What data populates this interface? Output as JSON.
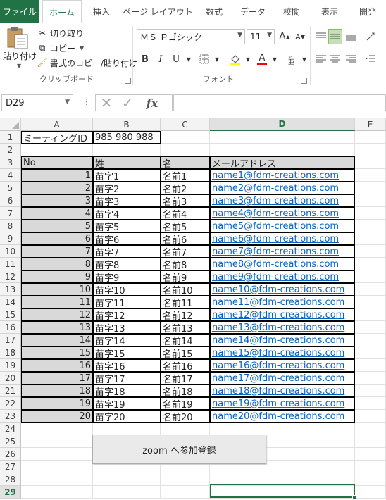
{
  "tabs": {
    "file": "ファイル",
    "items": [
      "ホーム",
      "挿入",
      "ページ レイアウト",
      "数式",
      "データ",
      "校閲",
      "表示",
      "開発"
    ]
  },
  "ribbon": {
    "clipboard": {
      "paste": "貼り付け",
      "cut": "切り取り",
      "copy": "コピー",
      "format_painter": "書式のコピー/貼り付け",
      "group_label": "クリップボード"
    },
    "font": {
      "font_name": "ＭＳ Ｐゴシック",
      "font_size": "11",
      "bold": "B",
      "italic": "I",
      "underline": "U",
      "font_color_letter": "A",
      "grow_font": "A",
      "shrink_font": "A",
      "group_label": "フォント"
    }
  },
  "formula_bar": {
    "name_box": "D29",
    "fx": "fx",
    "formula": ""
  },
  "columns": [
    "A",
    "B",
    "C",
    "D",
    "E"
  ],
  "rows": [
    "1",
    "2",
    "3",
    "4",
    "5",
    "6",
    "7",
    "8",
    "9",
    "10",
    "11",
    "12",
    "13",
    "14",
    "15",
    "16",
    "17",
    "18",
    "19",
    "20",
    "21",
    "22",
    "23",
    "24",
    "25",
    "26",
    "27",
    "28",
    "29"
  ],
  "sheet": {
    "meeting_label": "ミーティングID",
    "meeting_id": "985 980 988",
    "headers": [
      "No",
      "姓",
      "名",
      "メールアドレス"
    ],
    "records": [
      [
        "1",
        "苗字1",
        "名前1",
        "name1@fdm-creations.com"
      ],
      [
        "2",
        "苗字2",
        "名前2",
        "name2@fdm-creations.com"
      ],
      [
        "3",
        "苗字3",
        "名前3",
        "name3@fdm-creations.com"
      ],
      [
        "4",
        "苗字4",
        "名前4",
        "name4@fdm-creations.com"
      ],
      [
        "5",
        "苗字5",
        "名前5",
        "name5@fdm-creations.com"
      ],
      [
        "6",
        "苗字6",
        "名前6",
        "name6@fdm-creations.com"
      ],
      [
        "7",
        "苗字7",
        "名前7",
        "name7@fdm-creations.com"
      ],
      [
        "8",
        "苗字8",
        "名前8",
        "name8@fdm-creations.com"
      ],
      [
        "9",
        "苗字9",
        "名前9",
        "name9@fdm-creations.com"
      ],
      [
        "10",
        "苗字10",
        "名前10",
        "name10@fdm-creations.com"
      ],
      [
        "11",
        "苗字11",
        "名前11",
        "name11@fdm-creations.com"
      ],
      [
        "12",
        "苗字12",
        "名前12",
        "name12@fdm-creations.com"
      ],
      [
        "13",
        "苗字13",
        "名前13",
        "name13@fdm-creations.com"
      ],
      [
        "14",
        "苗字14",
        "名前14",
        "name14@fdm-creations.com"
      ],
      [
        "15",
        "苗字15",
        "名前15",
        "name15@fdm-creations.com"
      ],
      [
        "16",
        "苗字16",
        "名前16",
        "name16@fdm-creations.com"
      ],
      [
        "17",
        "苗字17",
        "名前17",
        "name17@fdm-creations.com"
      ],
      [
        "18",
        "苗字18",
        "名前18",
        "name18@fdm-creations.com"
      ],
      [
        "19",
        "苗字19",
        "名前19",
        "name19@fdm-creations.com"
      ],
      [
        "20",
        "苗字20",
        "名前20",
        "name20@fdm-creations.com"
      ]
    ],
    "button_label": "zoom へ参加登録"
  },
  "colors": {
    "accent": "#217346",
    "link": "#0563c1",
    "gray_fill": "#d9d9d9"
  }
}
